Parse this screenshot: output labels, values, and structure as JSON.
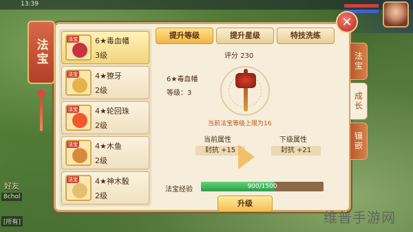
{
  "status_bar": {
    "time": "13:39"
  },
  "left_hud": {
    "friends_label": "好友",
    "channel_text": "8chol",
    "channel_text_2": "[所有]"
  },
  "banner": {
    "title": "法宝"
  },
  "close_button": {
    "symbol": "✕"
  },
  "treasure_list": [
    {
      "tag": "法宝",
      "name": "6★毒血幡",
      "level": "3级",
      "color": "#c8343a",
      "selected": true
    },
    {
      "tag": "法宝",
      "name": "4★獠牙",
      "level": "2级",
      "color": "#e6b24a",
      "selected": false
    },
    {
      "tag": "法宝",
      "name": "4★轮回珠",
      "level": "2级",
      "color": "#f05a2a",
      "selected": false
    },
    {
      "tag": "法宝",
      "name": "4★木鱼",
      "level": "2级",
      "color": "#d88a3a",
      "selected": false
    },
    {
      "tag": "法宝",
      "name": "4★神木骰",
      "level": "2级",
      "color": "#e2c070",
      "selected": false
    }
  ],
  "tabs": [
    "提升等级",
    "提升星级",
    "特技洗练"
  ],
  "detail": {
    "score_label": "评分",
    "score_value": "230",
    "name": "6★毒血幡",
    "level_text": "等级：3",
    "cap_text": "当前法宝等级上限为16",
    "current_attr_title": "当前属性",
    "current_attr_value": "封抗 +15",
    "next_attr_title": "下级属性",
    "next_attr_value": "封抗 +21",
    "exp_label": "法宝经验",
    "exp_text": "900/1500",
    "exp_fraction": 0.6,
    "upgrade_label": "升级"
  },
  "side_tabs": [
    {
      "label": "法宝",
      "active": false
    },
    {
      "label": "成长",
      "active": true
    },
    {
      "label": "镶嵌",
      "active": false
    }
  ],
  "watermark": "维普手游网"
}
